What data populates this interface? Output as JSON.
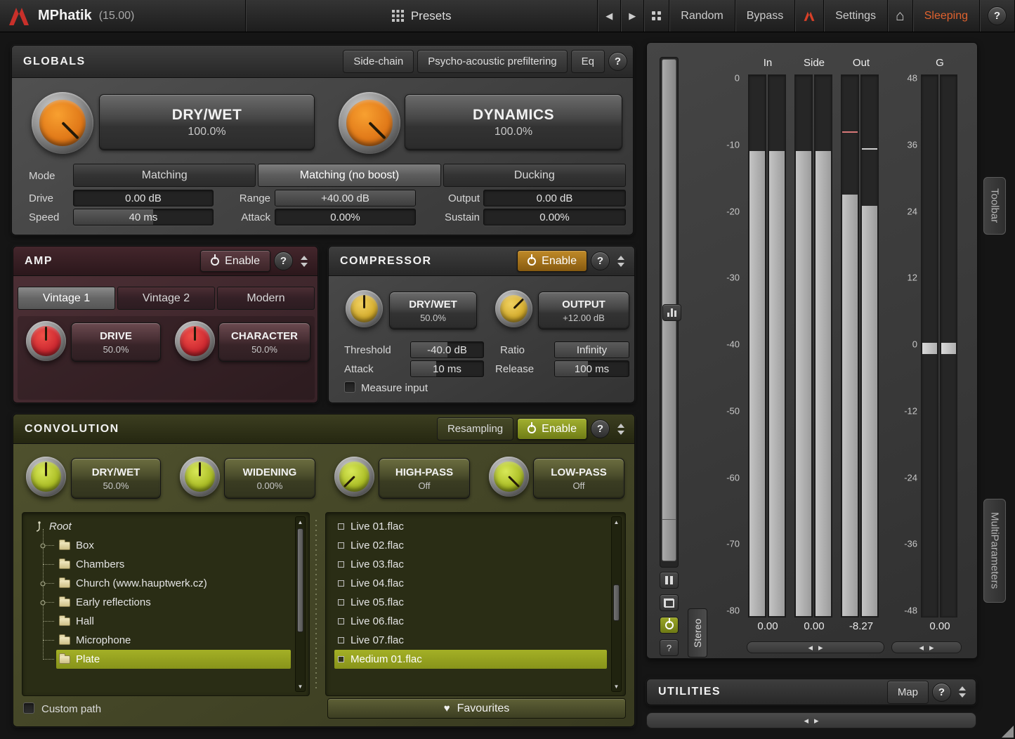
{
  "icons": {
    "question": "?",
    "prev": "◀",
    "next": "▶",
    "home": "⌂",
    "heart": "♥",
    "up": "▲",
    "down": "▼",
    "left": "◂",
    "right": "▸"
  },
  "titlebar": {
    "title": "MPhatik",
    "version": "(15.00)",
    "presets_label": "Presets",
    "random_label": "Random",
    "bypass_label": "Bypass",
    "settings_label": "Settings",
    "sleeping_label": "Sleeping"
  },
  "globals": {
    "title": "GLOBALS",
    "sidechain_label": "Side-chain",
    "psycho_label": "Psycho-acoustic prefiltering",
    "eq_label": "Eq",
    "drywet": {
      "label": "DRY/WET",
      "value": "100.0%"
    },
    "dynamics": {
      "label": "DYNAMICS",
      "value": "100.0%"
    },
    "mode_label": "Mode",
    "mode_options": [
      "Matching",
      "Matching (no boost)",
      "Ducking"
    ],
    "fields": {
      "drive": {
        "label": "Drive",
        "value": "0.00 dB"
      },
      "range": {
        "label": "Range",
        "value": "+40.00 dB"
      },
      "output": {
        "label": "Output",
        "value": "0.00 dB"
      },
      "speed": {
        "label": "Speed",
        "value": "40 ms"
      },
      "attack": {
        "label": "Attack",
        "value": "0.00%"
      },
      "sustain": {
        "label": "Sustain",
        "value": "0.00%"
      }
    }
  },
  "amp": {
    "title": "AMP",
    "enable_label": "Enable",
    "tabs": [
      "Vintage 1",
      "Vintage 2",
      "Modern"
    ],
    "drive": {
      "label": "DRIVE",
      "value": "50.0%"
    },
    "character": {
      "label": "CHARACTER",
      "value": "50.0%"
    }
  },
  "compressor": {
    "title": "COMPRESSOR",
    "enable_label": "Enable",
    "drywet": {
      "label": "DRY/WET",
      "value": "50.0%"
    },
    "output": {
      "label": "OUTPUT",
      "value": "+12.00 dB"
    },
    "threshold": {
      "label": "Threshold",
      "value": "-40.0 dB"
    },
    "ratio": {
      "label": "Ratio",
      "value": "Infinity"
    },
    "attack": {
      "label": "Attack",
      "value": "10 ms"
    },
    "release": {
      "label": "Release",
      "value": "100 ms"
    },
    "measure_input_label": "Measure input"
  },
  "convolution": {
    "title": "CONVOLUTION",
    "resampling_label": "Resampling",
    "enable_label": "Enable",
    "knobs": [
      {
        "label": "DRY/WET",
        "value": "50.0%"
      },
      {
        "label": "WIDENING",
        "value": "0.00%"
      },
      {
        "label": "HIGH-PASS",
        "value": "Off"
      },
      {
        "label": "LOW-PASS",
        "value": "Off"
      }
    ],
    "tree": {
      "root_label": "Root",
      "items": [
        {
          "label": "Box"
        },
        {
          "label": "Chambers"
        },
        {
          "label": "Church (www.hauptwerk.cz)"
        },
        {
          "label": "Early reflections"
        },
        {
          "label": "Hall"
        },
        {
          "label": "Microphone"
        },
        {
          "label": "Plate"
        }
      ],
      "selected": "Plate"
    },
    "files": [
      "Live 01.flac",
      "Live 02.flac",
      "Live 03.flac",
      "Live 04.flac",
      "Live 05.flac",
      "Live 06.flac",
      "Live 07.flac",
      "Medium 01.flac"
    ],
    "selected_file": "Medium 01.flac",
    "custom_path_label": "Custom path",
    "favourites_label": "Favourites"
  },
  "meters": {
    "headers": {
      "in": "In",
      "side": "Side",
      "out": "Out",
      "g": "G"
    },
    "left_scale": [
      "0",
      "-10",
      "-20",
      "-30",
      "-40",
      "-50",
      "-60",
      "-70",
      "-80"
    ],
    "right_scale": [
      "48",
      "36",
      "24",
      "12",
      "0",
      "-12",
      "-24",
      "-36",
      "-48"
    ],
    "values": {
      "in": "0.00",
      "side": "0.00",
      "out": "-8.27",
      "g": "0.00"
    },
    "levels": {
      "in": [
        -11.2,
        -11.2
      ],
      "side": [
        -11.2,
        -11.2
      ],
      "out": [
        -17.6,
        -19.3
      ],
      "out_peaks": [
        -8.27,
        -10.8
      ],
      "g": [
        0.5,
        0.5
      ]
    },
    "stereo_label": "Stereo"
  },
  "utilities": {
    "title": "UTILITIES",
    "map_label": "Map"
  },
  "edge": {
    "toolbar_label": "Toolbar",
    "multiparameters_label": "MultiParameters"
  }
}
